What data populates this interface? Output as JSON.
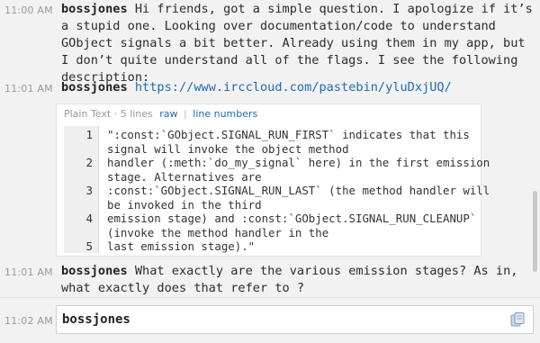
{
  "messages": [
    {
      "time": "11:00 AM",
      "nick": "bossjones",
      "lines": [
        "Hi friends, got a simple question. I apologize if it’s",
        "a stupid one. Looking over documentation/code to understand",
        "GObject signals a bit better. Already using them in my app, but",
        "I don’t quite understand all of the flags. I see the following",
        "description:"
      ]
    },
    {
      "time": "11:01 AM",
      "nick": "bossjones",
      "link": "https://www.irccloud.com/pastebin/yluDxjUQ/"
    },
    {
      "time": "11:01 AM",
      "nick": "bossjones",
      "lines": [
        "What exactly are the various emission stages? As in,",
        "what exactly does that refer to ?"
      ]
    }
  ],
  "paste": {
    "type": "Plain Text",
    "meta": "5 lines",
    "raw_label": "raw",
    "separator": "|",
    "line_numbers_label": "line numbers",
    "numbers": [
      "1",
      "2",
      "3",
      "4",
      "5"
    ],
    "code_lines": [
      "\":const:`GObject.SIGNAL_RUN_FIRST` indicates that this",
      "signal will invoke the object method",
      "handler (:meth:`do_my_signal` here) in the first emission",
      "stage. Alternatives are",
      ":const:`GObject.SIGNAL_RUN_LAST` (the method handler will",
      "be invoked in the third",
      "emission stage) and :const:`GObject.SIGNAL_RUN_CLEANUP`",
      "(invoke the method handler in the",
      "last emission stage).\""
    ]
  },
  "input": {
    "time": "11:02 AM",
    "text": "bossjones",
    "icon": "pastebin-icon"
  }
}
